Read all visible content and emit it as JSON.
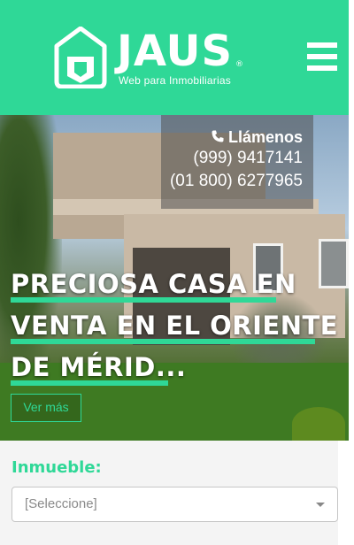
{
  "brand": {
    "name": "JAUS",
    "registered": "®",
    "tagline": "Web para Inmobiliarias",
    "color": "#2fd897"
  },
  "nav": {
    "menu_icon": "hamburger-menu-icon"
  },
  "contact": {
    "title": "Llámenos",
    "icon": "phone-icon",
    "phones": [
      "(999) 9417141",
      "(01 800) 6277965"
    ]
  },
  "hero": {
    "headline_lines": [
      "PRECIOSA CASA EN",
      "VENTA EN EL ORIENTE",
      "DE MÉRID..."
    ],
    "cta_label": "Ver más"
  },
  "search": {
    "property_label": "Inmueble:",
    "property_select_value": "[Seleccione]"
  }
}
